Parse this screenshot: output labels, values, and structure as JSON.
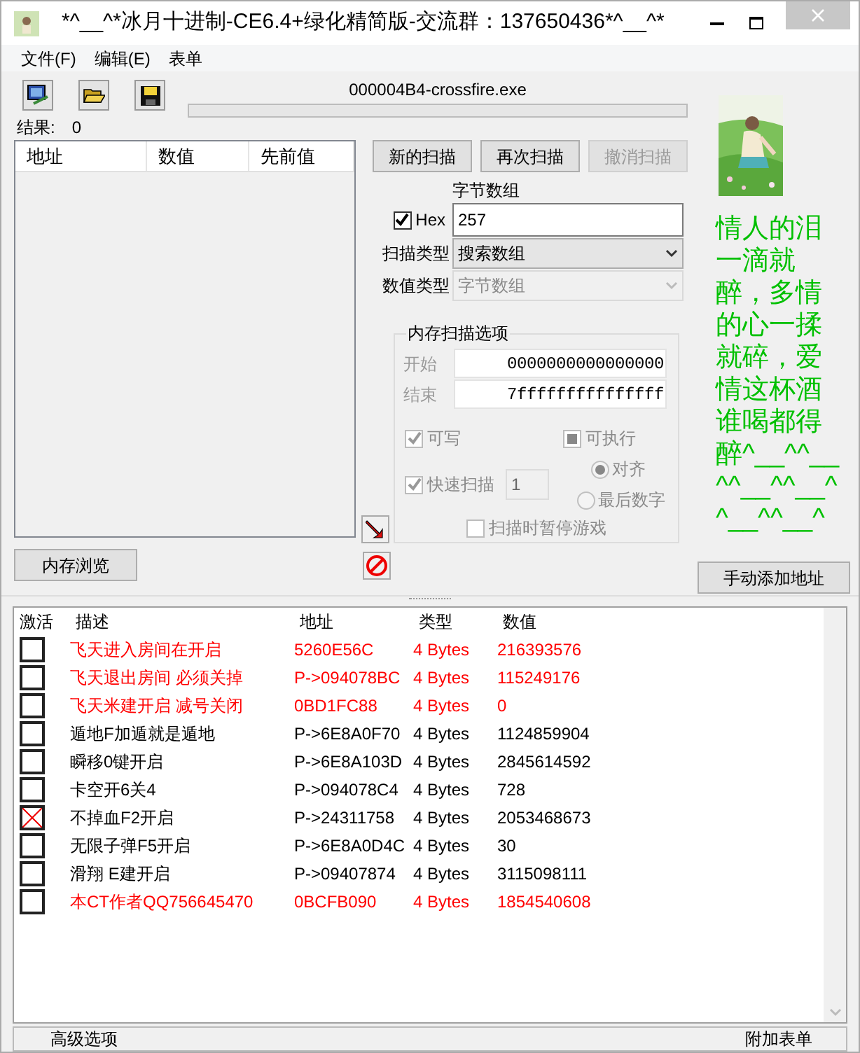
{
  "window": {
    "title": "*^__^*冰月十进制-CE6.4+绿化精简版-交流群：137650436*^__^*"
  },
  "menu": [
    "文件(F)",
    "编辑(E)",
    "表单"
  ],
  "process": {
    "name": "000004B4-crossfire.exe",
    "level": 0
  },
  "results": {
    "label": "结果:",
    "value": "0"
  },
  "found_list": {
    "columns": [
      "地址",
      "数值",
      "先前值"
    ]
  },
  "scan_buttons": [
    {
      "label": "新的扫描",
      "disabled": false
    },
    {
      "label": "再次扫描",
      "disabled": false
    },
    {
      "label": "撤消扫描",
      "disabled": true
    }
  ],
  "value_label": "字节数组",
  "hex": {
    "label": "Hex",
    "checked": true
  },
  "value": "257",
  "scan_type": {
    "label": "扫描类型",
    "value": "搜索数组",
    "disabled": false
  },
  "value_type": {
    "label": "数值类型",
    "value": "字节数组",
    "disabled": true
  },
  "memory_options": {
    "title": "内存扫描选项",
    "disabled": true,
    "start": {
      "label": "开始",
      "value": "0000000000000000"
    },
    "stop": {
      "label": "结束",
      "value": "7fffffffffffffff"
    },
    "writable": {
      "label": "可写",
      "checked": true
    },
    "executable": {
      "label": "可执行",
      "checked": false,
      "indeterminate": true
    },
    "fast_scan": {
      "label": "快速扫描",
      "checked": true,
      "value": "1"
    },
    "alignment": [
      {
        "label": "对齐",
        "selected": true
      },
      {
        "label": "最后数字",
        "selected": false
      }
    ],
    "pause": {
      "label": "扫描时暂停游戏",
      "checked": false
    }
  },
  "banner": "情人的泪一滴就醉，多情的心一揉就碎，爱情这杯酒谁喝都得醉^__^^__^^__^^__^^__^^__^",
  "memory_view_button": "内存浏览",
  "add_address_button": "手动添加地址",
  "table": {
    "columns": [
      "激活",
      "描述",
      "地址",
      "类型",
      "数值"
    ],
    "rows": [
      {
        "active": false,
        "description": "飞天进入房间在开启",
        "address": "5260E56C",
        "type": "4 Bytes",
        "value": "216393576",
        "color": "#ff0000"
      },
      {
        "active": false,
        "description": "飞天退出房间 必须关掉",
        "address": "P->094078BC",
        "type": "4 Bytes",
        "value": "115249176",
        "color": "#ff0000"
      },
      {
        "active": false,
        "description": "飞天米建开启  减号关闭",
        "address": "0BD1FC88",
        "type": "4 Bytes",
        "value": "0",
        "color": "#ff0000"
      },
      {
        "active": false,
        "description": "遁地F加遁就是遁地",
        "address": "P->6E8A0F70",
        "type": "4 Bytes",
        "value": "1124859904",
        "color": "#000000"
      },
      {
        "active": false,
        "description": "瞬移0键开启",
        "address": "P->6E8A103D",
        "type": "4 Bytes",
        "value": "2845614592",
        "color": "#000000"
      },
      {
        "active": false,
        "description": "卡空开6关4",
        "address": "P->094078C4",
        "type": "4 Bytes",
        "value": "728",
        "color": "#000000"
      },
      {
        "active": true,
        "description": "不掉血F2开启",
        "address": "P->24311758",
        "type": "4 Bytes",
        "value": "2053468673",
        "color": "#000000"
      },
      {
        "active": false,
        "description": "无限子弹F5开启",
        "address": "P->6E8A0D4C",
        "type": "4 Bytes",
        "value": "30",
        "color": "#000000"
      },
      {
        "active": false,
        "description": "滑翔 E建开启",
        "address": "P->09407874",
        "type": "4 Bytes",
        "value": "3115098111",
        "color": "#000000"
      },
      {
        "active": false,
        "description": "本CT作者QQ756645470",
        "address": "0BCFB090",
        "type": "4 Bytes",
        "value": "1854540608",
        "color": "#ff0000"
      }
    ]
  },
  "bottom_bar": {
    "left": "高级选项",
    "right": "附加表单"
  }
}
